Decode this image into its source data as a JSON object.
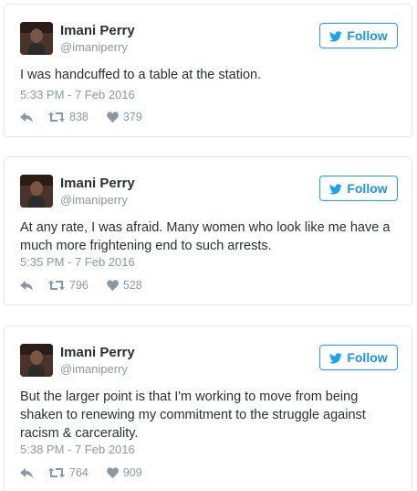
{
  "tweets": [
    {
      "name": "Imani Perry",
      "handle": "@imaniperry",
      "follow_label": "Follow",
      "text": "I was handcuffed to a table at the station.",
      "timestamp": "5:33 PM - 7 Feb 2016",
      "retweets": "838",
      "likes": "379"
    },
    {
      "name": "Imani Perry",
      "handle": "@imaniperry",
      "follow_label": "Follow",
      "text": "At any rate, I was afraid. Many women who look like me have a much more frightening end to such arrests.",
      "timestamp": "5:35 PM - 7 Feb 2016",
      "retweets": "796",
      "likes": "528"
    },
    {
      "name": "Imani Perry",
      "handle": "@imaniperry",
      "follow_label": "Follow",
      "text": "But the larger point is that I'm working to move from being shaken to renewing my commitment to the struggle against racism & carcerality.",
      "timestamp": "5:38 PM - 7 Feb 2016",
      "retweets": "764",
      "likes": "909"
    }
  ],
  "icons": {
    "follow": "twitter-bird-icon",
    "reply": "reply-icon",
    "retweet": "retweet-icon",
    "like": "heart-icon"
  },
  "colors": {
    "accent": "#1da1f2",
    "muted": "#8899a6",
    "text": "#292f33",
    "border": "#e1e8ed"
  }
}
